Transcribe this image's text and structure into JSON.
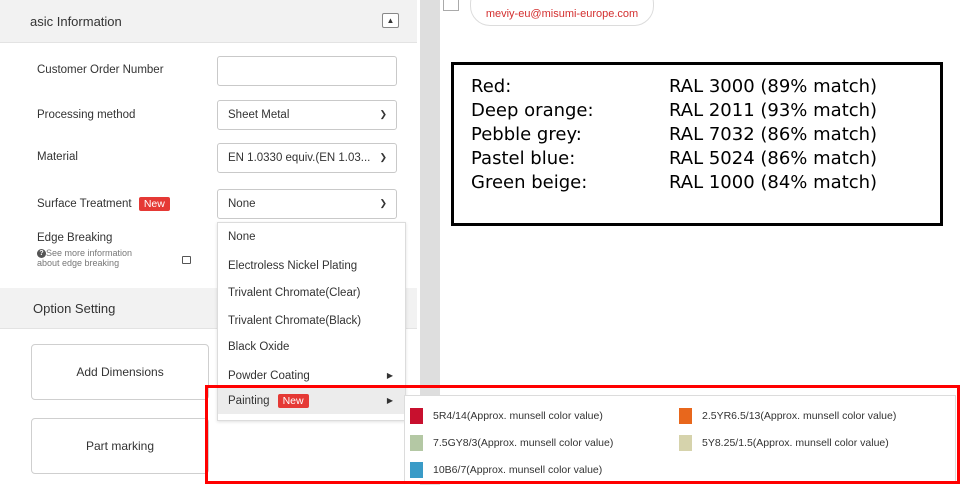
{
  "basic_info": {
    "title": "asic Information",
    "collapse_icon": "▲"
  },
  "form": {
    "customer_order_label": "Customer Order Number",
    "customer_order_value": "",
    "processing_label": "Processing method",
    "processing_value": "Sheet Metal",
    "material_label": "Material",
    "material_value": "EN 1.0330 equiv.(EN 1.03...",
    "surface_label": "Surface Treatment",
    "surface_value": "None",
    "edge_label": "Edge Breaking",
    "edge_info_line1": "See more information",
    "edge_info_line2": "about edge breaking",
    "new_badge": "New"
  },
  "option_setting": {
    "title": "Option Setting"
  },
  "buttons": {
    "add_dimensions": "Add Dimensions",
    "part_marking": "Part marking"
  },
  "dropdown": {
    "items": [
      "None",
      "Electroless Nickel Plating",
      "Trivalent Chromate(Clear)",
      "Trivalent Chromate(Black)",
      "Black Oxide",
      "Powder Coating",
      "Painting"
    ],
    "arrow": "▶"
  },
  "contact": {
    "email": "meviy-eu@misumi-europe.com"
  },
  "ral_matches": [
    {
      "name": "Red:",
      "value": "RAL 3000 (89% match)"
    },
    {
      "name": "Deep orange:",
      "value": "RAL 2011 (93% match)"
    },
    {
      "name": "Pebble grey:",
      "value": "RAL 7032 (86% match)"
    },
    {
      "name": "Pastel blue:",
      "value": "RAL 5024 (86% match)"
    },
    {
      "name": "Green beige:",
      "value": "RAL 1000 (84% match)"
    }
  ],
  "painting_colors": [
    {
      "label": "5R4/14(Approx. munsell color value)",
      "color": "#c8102e"
    },
    {
      "label": "2.5YR6.5/13(Approx. munsell color value)",
      "color": "#e8671c"
    },
    {
      "label": "7.5GY8/3(Approx. munsell color value)",
      "color": "#b4c8a4"
    },
    {
      "label": "5Y8.25/1.5(Approx. munsell color value)",
      "color": "#d6d3ac"
    },
    {
      "label": "10B6/7(Approx. munsell color value)",
      "color": "#3a9bc7"
    }
  ],
  "colors": {
    "accent_red": "#e53935",
    "highlight_outline": "#ff0000"
  }
}
